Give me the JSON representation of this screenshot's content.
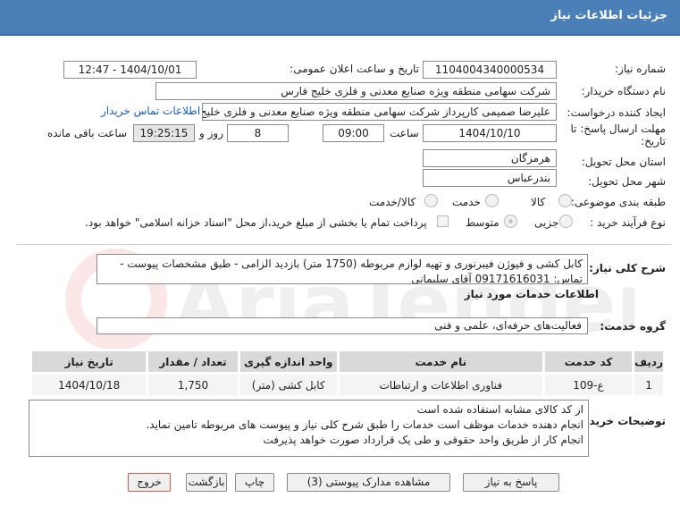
{
  "header": {
    "title": "جزئیات اطلاعات نیاز"
  },
  "form": {
    "need_number_label": "شماره نیاز:",
    "need_number": "1104004340000534",
    "announce_label": "تاریخ و ساعت اعلان عمومی:",
    "announce_value": "1404/10/01 - 12:47",
    "buyer_label": "نام دستگاه خریدار:",
    "buyer_value": "شرکت سهامی منطقه ویژه صنایع معدنی و فلزی خلیج فارس",
    "creator_label": "ایجاد کننده درخواست:",
    "creator_value": "علیرضا صمیمی کارپرداز شرکت سهامی منطقه ویژه صنایع معدنی و فلزی خلیج فارس",
    "contact_link": "اطلاعات تماس خریدار",
    "deadline_label_1": "مهلت ارسال پاسخ: تا",
    "deadline_label_2": "تاریخ:",
    "deadline_date": "1404/10/10",
    "time_label": "ساعت",
    "deadline_time": "09:00",
    "days_value": "8",
    "days_label": "روز و",
    "remaining_time": "19:25:15",
    "remaining_label": "ساعت باقی مانده",
    "province_label": "استان محل تحویل:",
    "province_value": "هرمزگان",
    "city_label": "شهر محل تحویل:",
    "city_value": "بندرعباس",
    "category_label": "طبقه بندی موضوعی:",
    "category_options": [
      "کالا",
      "خدمت",
      "کالا/خدمت"
    ],
    "process_label": "نوع فرآیند خرید :",
    "process_options": [
      "جزیی",
      "متوسط"
    ],
    "payment_note": "پرداخت تمام یا بخشی از مبلغ خرید،از محل \"اسناد خزانه اسلامی\" خواهد بود."
  },
  "summary": {
    "label": "شرح کلی نیاز:",
    "text": "کابل کشی و فیوژن فیبرنوری و تهیه لوازم مربوطه (1750 متر) بازدید الزامی - طبق مشخصات پیوست - تماس: 09171616031 آقای سلیمانی"
  },
  "services": {
    "section_title": "اطلاعات خدمات مورد نیاز",
    "group_label": "گروه خدمت:",
    "group_value": "فعالیت‌های حرفه‌ای، علمی و فنی",
    "columns": [
      "ردیف",
      "کد خدمت",
      "نام خدمت",
      "واحد اندازه گیری",
      "تعداد / مقدار",
      "تاریخ نیاز"
    ],
    "rows": [
      {
        "row": "1",
        "code": "ع-109",
        "name": "فناوری اطلاعات و ارتباطات",
        "unit": "کابل کشی (متر)",
        "qty": "1,750",
        "date": "1404/10/18"
      }
    ]
  },
  "buyer_notes": {
    "label": "توضیحات خریدار:",
    "lines": [
      "از کد کالای مشابه استفاده شده است",
      "انجام دهنده خدمات موظف است خدمات را طبق شرح کلی نیاز و پیوست های مربوطه تامین نماید.",
      "انجام کار از طریق واحد حقوقی و طی یک قرارداد صورت خواهد پذیرفت"
    ]
  },
  "buttons": {
    "reply": "پاسخ به نیاز",
    "attachments": "مشاهده مدارک پیوستی (3)",
    "print": "چاپ",
    "back": "بازگشت",
    "exit": "خروج"
  },
  "watermark": {
    "text": "AriaTender.net"
  }
}
